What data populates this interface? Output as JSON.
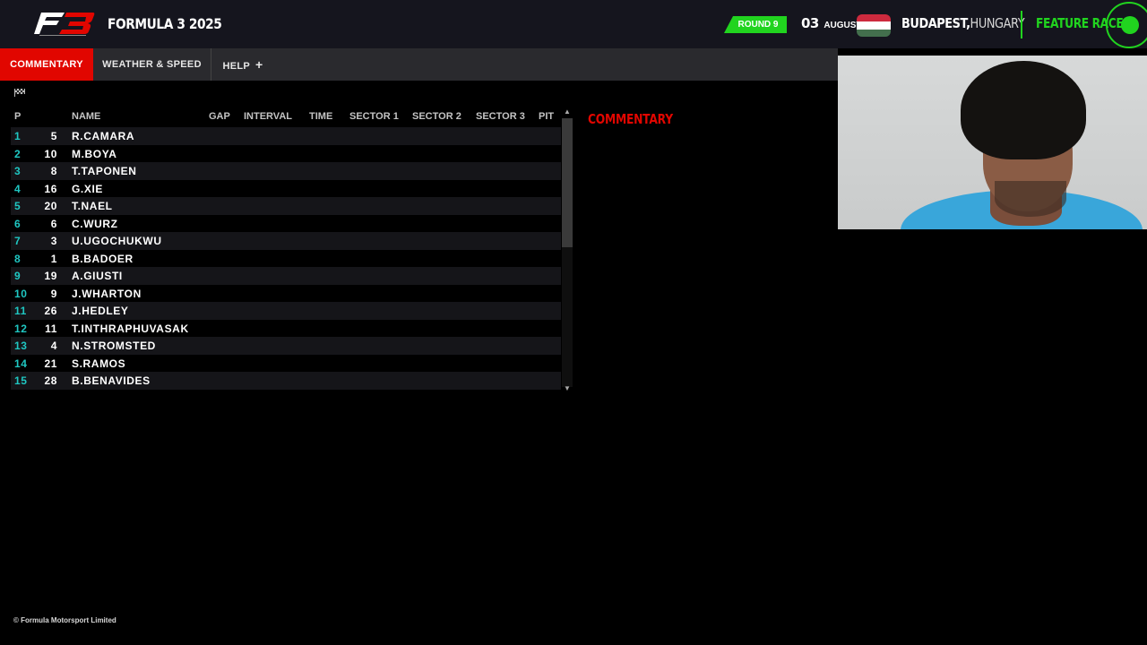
{
  "header": {
    "series_title": "FORMULA 3 2025",
    "round": "ROUND 9",
    "date_day": "03",
    "date_month": "AUGUST",
    "location_city": "BUDAPEST,",
    "location_country": "HUNGARY",
    "session": "FEATURE RACE",
    "flag_colors": [
      "#cd2a3e",
      "#ffffff",
      "#436f4d"
    ]
  },
  "nav": {
    "tabs": [
      {
        "label": "COMMENTARY"
      },
      {
        "label": "WEATHER & SPEED"
      },
      {
        "label": "HELP"
      }
    ],
    "help_plus": "+"
  },
  "timing": {
    "columns": {
      "p": "P",
      "name": "NAME",
      "gap": "GAP",
      "interval": "INTERVAL",
      "time": "TIME",
      "sector1": "SECTOR 1",
      "sector2": "SECTOR 2",
      "sector3": "SECTOR 3",
      "pit": "PIT"
    },
    "rows": [
      {
        "pos": "1",
        "num": "5",
        "name": "R.CAMARA"
      },
      {
        "pos": "2",
        "num": "10",
        "name": "M.BOYA"
      },
      {
        "pos": "3",
        "num": "8",
        "name": "T.TAPONEN"
      },
      {
        "pos": "4",
        "num": "16",
        "name": "G.XIE"
      },
      {
        "pos": "5",
        "num": "20",
        "name": "T.NAEL"
      },
      {
        "pos": "6",
        "num": "6",
        "name": "C.WURZ"
      },
      {
        "pos": "7",
        "num": "3",
        "name": "U.UGOCHUKWU"
      },
      {
        "pos": "8",
        "num": "1",
        "name": "B.BADOER"
      },
      {
        "pos": "9",
        "num": "19",
        "name": "A.GIUSTI"
      },
      {
        "pos": "10",
        "num": "9",
        "name": "J.WHARTON"
      },
      {
        "pos": "11",
        "num": "26",
        "name": "J.HEDLEY"
      },
      {
        "pos": "12",
        "num": "11",
        "name": "T.INTHRAPHUVASAK"
      },
      {
        "pos": "13",
        "num": "4",
        "name": "N.STROMSTED"
      },
      {
        "pos": "14",
        "num": "21",
        "name": "S.RAMOS"
      },
      {
        "pos": "15",
        "num": "28",
        "name": "B.BENAVIDES"
      }
    ]
  },
  "commentary": {
    "title": "COMMENTARY"
  },
  "footer": {
    "copyright": "© Formula Motorsport Limited"
  },
  "colors": {
    "accent_red": "#e10600",
    "accent_green": "#21d41f",
    "position_teal": "#1fc7c2"
  }
}
